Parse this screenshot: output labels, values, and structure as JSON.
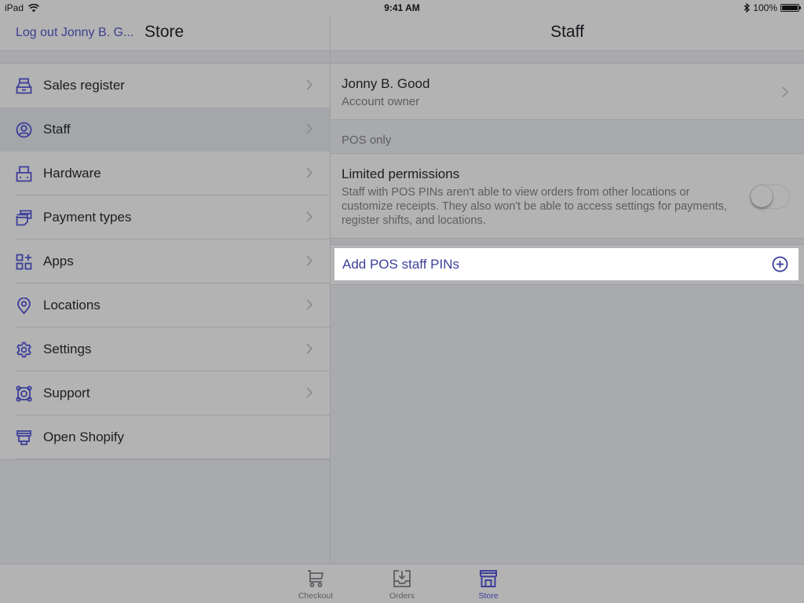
{
  "status_bar": {
    "device": "iPad",
    "time": "9:41 AM",
    "battery": "100%",
    "battery_level": 1.0
  },
  "colors": {
    "accent": "#3c3f9a",
    "text": "#1c1d22",
    "secondary_text": "#5c5d62"
  },
  "left_nav": {
    "logout_label": "Log out Jonny B. G...",
    "title": "Store"
  },
  "right_nav": {
    "title": "Staff"
  },
  "sidebar": {
    "items": [
      {
        "label": "Sales register",
        "icon": "cash-register-icon",
        "chevron": true
      },
      {
        "label": "Staff",
        "icon": "user-circle-icon",
        "chevron": true,
        "selected": true
      },
      {
        "label": "Hardware",
        "icon": "printer-icon",
        "chevron": true
      },
      {
        "label": "Payment types",
        "icon": "credit-cards-icon",
        "chevron": true
      },
      {
        "label": "Apps",
        "icon": "apps-grid-icon",
        "chevron": true
      },
      {
        "label": "Locations",
        "icon": "location-pin-icon",
        "chevron": true
      },
      {
        "label": "Settings",
        "icon": "gear-icon",
        "chevron": true
      },
      {
        "label": "Support",
        "icon": "lifebuoy-icon",
        "chevron": true
      },
      {
        "label": "Open Shopify",
        "icon": "storefront-icon",
        "chevron": false
      }
    ]
  },
  "staff": {
    "owner": {
      "name": "Jonny B. Good",
      "role": "Account owner"
    },
    "section_header": "POS only",
    "limited_permissions": {
      "title": "Limited permissions",
      "description": "Staff with POS PINs aren't able to view orders from other locations or customize receipts. They also won't be able to access settings for payments, register shifts, and locations.",
      "enabled": false
    },
    "add_pins_label": "Add POS staff PINs"
  },
  "tabbar": {
    "tabs": [
      {
        "label": "Checkout",
        "icon": "cart-icon",
        "active": false
      },
      {
        "label": "Orders",
        "icon": "inbox-download-icon",
        "active": false
      },
      {
        "label": "Store",
        "icon": "store-icon",
        "active": true
      }
    ]
  }
}
